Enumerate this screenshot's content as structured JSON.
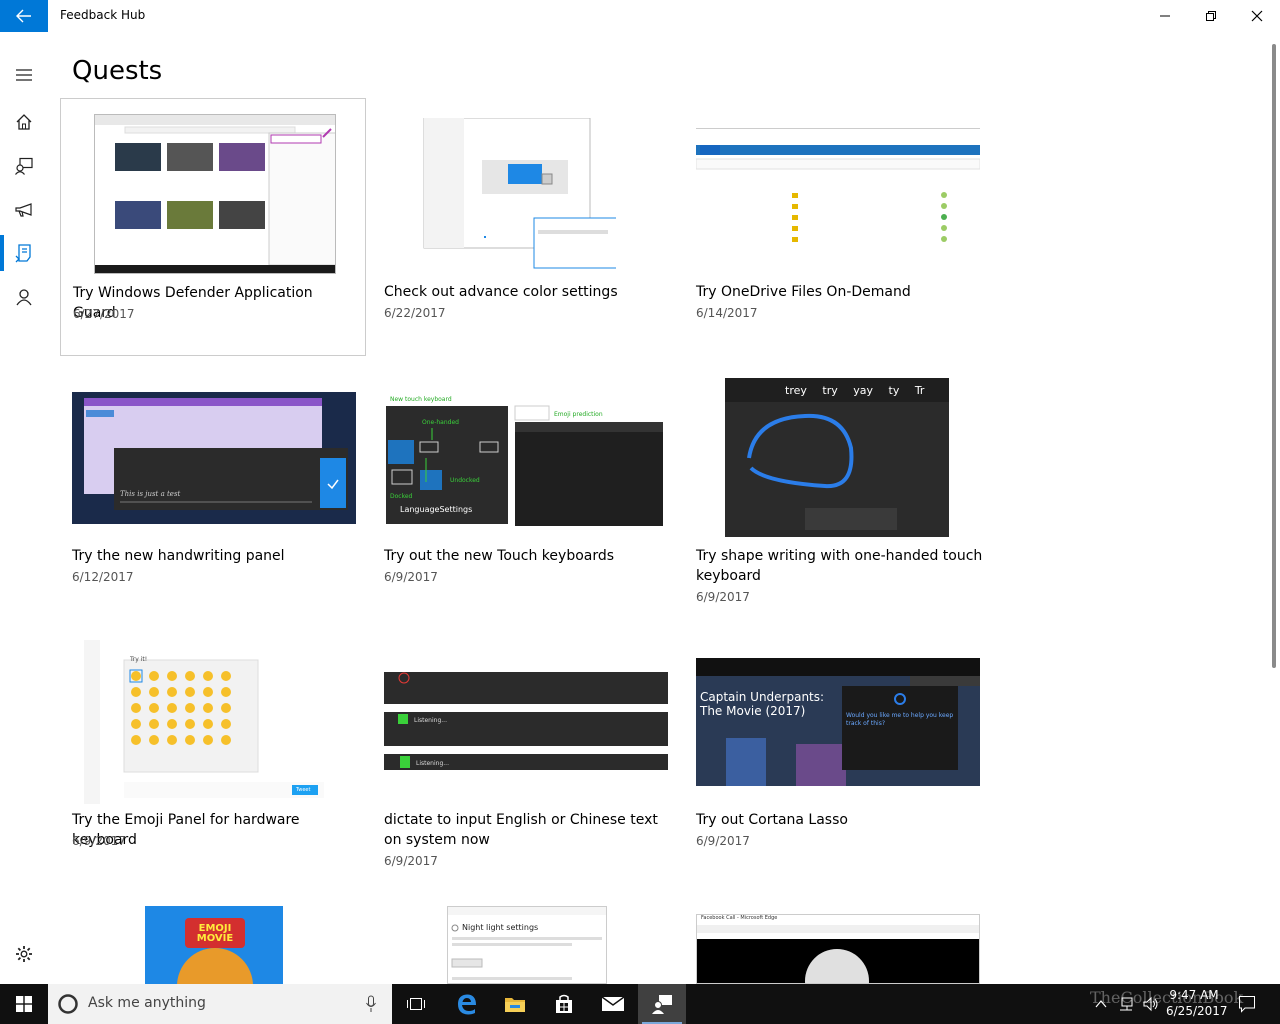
{
  "window": {
    "title": "Feedback Hub"
  },
  "page": {
    "title": "Quests"
  },
  "nav": {
    "items": [
      {
        "name": "menu",
        "icon": "hamburger-icon"
      },
      {
        "name": "home",
        "icon": "home-icon"
      },
      {
        "name": "feedback",
        "icon": "feedback-icon"
      },
      {
        "name": "announcements",
        "icon": "megaphone-icon"
      },
      {
        "name": "quests",
        "icon": "quests-icon",
        "active": true
      },
      {
        "name": "profile",
        "icon": "person-icon"
      },
      {
        "name": "settings",
        "icon": "gear-icon"
      }
    ]
  },
  "quests": [
    {
      "title": "Try Windows Defender Application Guard",
      "date": "6/27/2017",
      "thumb": "browser"
    },
    {
      "title": "Check out advance color settings",
      "date": "6/22/2017",
      "thumb": "settings"
    },
    {
      "title": "Try OneDrive Files On-Demand",
      "date": "6/14/2017",
      "thumb": "explorer"
    },
    {
      "title": "Try the new handwriting panel",
      "date": "6/12/2017",
      "thumb": "handwriting",
      "handwriting_text": "This is just a test"
    },
    {
      "title": "Try out the new Touch keyboards",
      "date": "6/9/2017",
      "thumb": "keyboards",
      "labels": {
        "new": "New touch keyboard",
        "onehanded": "One-handed",
        "undocked": "Undocked",
        "docked": "Docked",
        "lang": "LanguageSettings",
        "emoji": "Emoji prediction"
      }
    },
    {
      "title": "Try shape writing with one-handed touch keyboard",
      "date": "6/9/2017",
      "thumb": "shapewriting",
      "suggestions": [
        "trey",
        "try",
        "yay",
        "ty",
        "Tr"
      ]
    },
    {
      "title": "Try the Emoji Panel for hardware keyboard",
      "date": "6/9/2017",
      "thumb": "emoji",
      "tryit": "Try it!",
      "tweet": "Tweet"
    },
    {
      "title": "dictate to input English or Chinese text on system now",
      "date": "6/9/2017",
      "thumb": "dictate",
      "listening": "Listening..."
    },
    {
      "title": "Try out Cortana Lasso",
      "date": "6/9/2017",
      "thumb": "cortana",
      "movie": "Captain Underpants: The Movie (2017)",
      "prompt": "Would you like me to help you keep track of this?"
    },
    {
      "title": "",
      "date": "",
      "thumb": "emojimovie",
      "poster_text": "EMOJI MOVIE"
    },
    {
      "title": "",
      "date": "",
      "thumb": "nightlight",
      "heading": "Night light settings"
    },
    {
      "title": "",
      "date": "",
      "thumb": "edge",
      "window_title": "Facebook Call - Microsoft Edge"
    }
  ],
  "taskbar": {
    "search_placeholder": "Ask me anything",
    "time": "9:47 AM",
    "date": "6/25/2017",
    "watermark": "TheCollectionBook",
    "apps": [
      "task-view-icon",
      "edge-icon",
      "file-explorer-icon",
      "store-icon",
      "mail-icon",
      "feedback-hub-icon"
    ]
  },
  "colors": {
    "accent": "#0078d7",
    "taskbar": "#101010"
  }
}
